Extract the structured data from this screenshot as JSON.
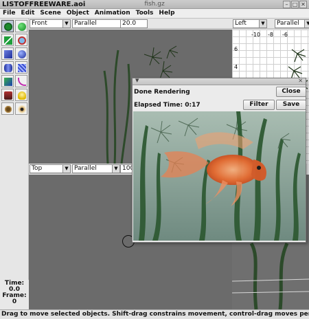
{
  "window": {
    "title": "LISTOFFREEWARE.aoi",
    "file": "fish.gz",
    "min": "–",
    "max": "□",
    "close": "✕"
  },
  "menu": [
    "File",
    "Edit",
    "Scene",
    "Object",
    "Animation",
    "Tools",
    "Help"
  ],
  "tools": [
    "move-tool",
    "rotate-tool",
    "scale-tool",
    "camera-tool",
    "cube-tool",
    "sphere-tool",
    "cylinder-tool",
    "spline-tool",
    "polygon-tool",
    "curve-tool",
    "texture-tool",
    "light-tool",
    "skeleton-tool",
    "view-tool"
  ],
  "views": {
    "front": {
      "view": "Front",
      "projection": "Parallel",
      "scale": "20.0"
    },
    "top": {
      "view": "Top",
      "projection": "Parallel",
      "scale": "100"
    },
    "left": {
      "view": "Left",
      "projection": "Parallel",
      "ticks_x": [
        "-10",
        "-8",
        "-6"
      ],
      "ticks_y": [
        "6",
        "4"
      ]
    }
  },
  "time_panel": {
    "time_label": "Time:",
    "time_value": "0.0",
    "frame_label": "Frame:",
    "frame_value": "0"
  },
  "dialog": {
    "status": "Done Rendering",
    "elapsed": "Elapsed Time: 0:17",
    "close_label": "Close",
    "filter_label": "Filter",
    "save_label": "Save"
  },
  "status_bar": "Drag to move selected objects.  Shift-drag constrains movement, control-drag moves perpendicular to"
}
